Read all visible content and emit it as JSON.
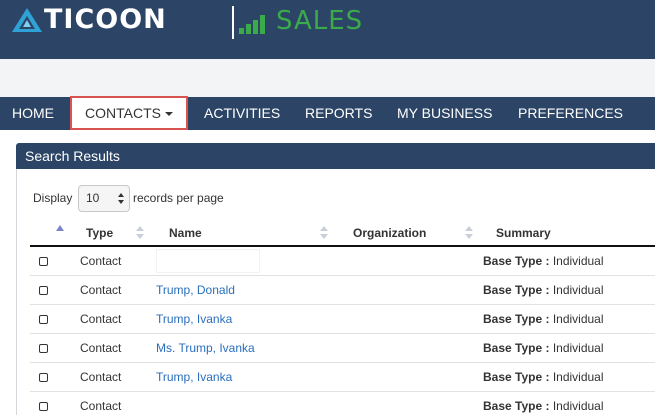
{
  "brand": {
    "logo_text": "TICOON",
    "product_text": "SALES",
    "accent_color": "#3aaa4a",
    "header_color": "#2c4566"
  },
  "nav": {
    "items": [
      {
        "label": "HOME"
      },
      {
        "label": "CONTACTS",
        "active": true,
        "highlight_color": "#d9534f"
      },
      {
        "label": "ACTIVITIES"
      },
      {
        "label": "REPORTS"
      },
      {
        "label": "MY BUSINESS"
      },
      {
        "label": "PREFERENCES"
      }
    ]
  },
  "panel": {
    "title": "Search Results"
  },
  "pagination": {
    "display_label": "Display",
    "page_size": "10",
    "records_label": "records per page"
  },
  "table": {
    "columns": [
      "Type",
      "Name",
      "Organization",
      "Summary"
    ],
    "rows": [
      {
        "type": "Contact",
        "name": "",
        "organization": "",
        "summary_key": "Base Type :",
        "summary_value": "Individual"
      },
      {
        "type": "Contact",
        "name": "Trump, Donald",
        "organization": "",
        "summary_key": "Base Type :",
        "summary_value": "Individual"
      },
      {
        "type": "Contact",
        "name": "Trump, Ivanka",
        "organization": "",
        "summary_key": "Base Type :",
        "summary_value": "Individual"
      },
      {
        "type": "Contact",
        "name": "Ms. Trump, Ivanka",
        "organization": "",
        "summary_key": "Base Type :",
        "summary_value": "Individual"
      },
      {
        "type": "Contact",
        "name": "Trump, Ivanka",
        "organization": "",
        "summary_key": "Base Type :",
        "summary_value": "Individual"
      },
      {
        "type": "Contact",
        "name": "",
        "organization": "",
        "summary_key": "Base Type :",
        "summary_value": "Individual"
      }
    ]
  }
}
